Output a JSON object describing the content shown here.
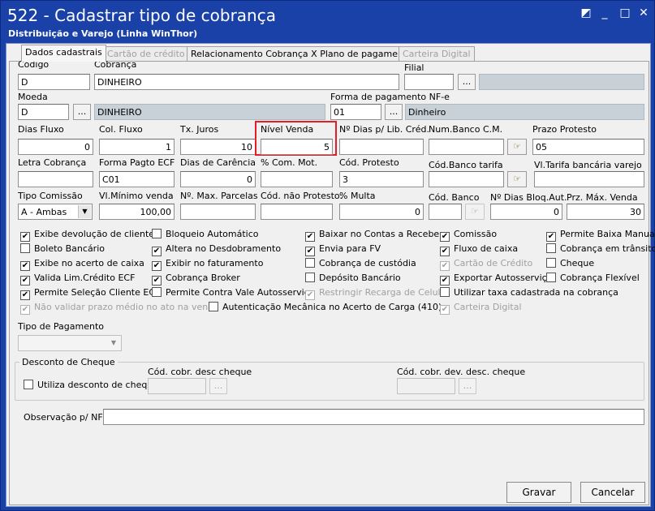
{
  "window": {
    "title": "522 - Cadastrar tipo de cobrança",
    "subtitle": "Distribuição e Varejo (Linha WinThor)",
    "btn_restore": "◩",
    "btn_min": "_",
    "btn_max": "□",
    "btn_close": "✕"
  },
  "tabs": [
    "Dados cadastrais",
    "Cartão de crédito",
    "Relacionamento Cobrança X Plano de pagamento",
    "Carteira Digital"
  ],
  "fields": {
    "codigo": {
      "label": "Código",
      "value": "D"
    },
    "cobranca": {
      "label": "Cobrança",
      "value": "DINHEIRO"
    },
    "filial": {
      "label": "Filial",
      "value": ""
    },
    "moeda": {
      "label": "Moeda",
      "value": "D",
      "desc": "DINHEIRO"
    },
    "forma_pag_nfe": {
      "label": "Forma de pagamento NF-e",
      "value": "01",
      "desc": "Dinheiro"
    },
    "dias_fluxo": {
      "label": "Dias Fluxo",
      "value": "0"
    },
    "col_fluxo": {
      "label": "Col. Fluxo",
      "value": "1"
    },
    "tx_juros": {
      "label": "Tx. Juros",
      "value": "10"
    },
    "nivel_venda": {
      "label": "Nível Venda",
      "value": "5"
    },
    "n_dias_lib": {
      "label": "Nº Dias p/ Lib. Créd.",
      "value": ""
    },
    "num_banco_cm": {
      "label": "Num.Banco C.M.",
      "value": ""
    },
    "prazo_protesto": {
      "label": "Prazo Protesto",
      "value": "05"
    },
    "letra_cobranca": {
      "label": "Letra Cobrança",
      "value": ""
    },
    "forma_pagto_ecf": {
      "label": "Forma Pagto ECF",
      "value": "C01"
    },
    "dias_carencia": {
      "label": "Dias de Carência",
      "value": "0"
    },
    "com_mot": {
      "label": "% Com. Mot.",
      "value": ""
    },
    "cod_protesto": {
      "label": "Cód. Protesto",
      "value": "3"
    },
    "cod_banco_tarifa": {
      "label": "Cód.Banco tarifa",
      "value": ""
    },
    "vl_tarifa": {
      "label": "Vl.Tarifa bancária varejo",
      "value": ""
    },
    "tipo_comissao": {
      "label": "Tipo Comissão",
      "value": "A - Ambas"
    },
    "vl_minimo": {
      "label": "Vl.Mínimo venda",
      "value": "100,00"
    },
    "n_max_parcelas": {
      "label": "Nº. Max. Parcelas",
      "value": ""
    },
    "cod_nao_protesto": {
      "label": "Cód. não Protesto.",
      "value": ""
    },
    "multa": {
      "label": "% Multa",
      "value": "0"
    },
    "cod_banco": {
      "label": "Cód. Banco",
      "value": ""
    },
    "n_dias_bloq": {
      "label": "Nº Dias Bloq.Aut.",
      "value": "0"
    },
    "prz_max_venda": {
      "label": "Prz. Máx. Venda",
      "value": "30"
    }
  },
  "dots": "...",
  "checkboxes": {
    "c1": {
      "label": "Exibe devolução de cliente",
      "checked": "✔"
    },
    "c2": {
      "label": "Boleto Bancário",
      "checked": ""
    },
    "c3": {
      "label": "Exibe no acerto de caixa",
      "checked": "✔"
    },
    "c4": {
      "label": "Valida Lim.Crédito ECF",
      "checked": "✔"
    },
    "c5": {
      "label": "Permite Seleção Cliente ECF",
      "checked": "✔"
    },
    "c6": {
      "label": "Não validar prazo médio no ato na venda",
      "checked": "✔"
    },
    "c7": {
      "label": "Bloqueio Automático",
      "checked": ""
    },
    "c8": {
      "label": "Altera no Desdobramento",
      "checked": "✔"
    },
    "c9": {
      "label": "Exibir no faturamento",
      "checked": "✔"
    },
    "c10": {
      "label": "Cobrança Broker",
      "checked": "✔"
    },
    "c11": {
      "label": "Permite Contra Vale Autosserviço",
      "checked": ""
    },
    "c12": {
      "label": "Autenticação Mecânica no Acerto de Carga (410)",
      "checked": ""
    },
    "c13": {
      "label": "Baixar no Contas a Receber",
      "checked": "✔"
    },
    "c14": {
      "label": "Envia para FV",
      "checked": "✔"
    },
    "c15": {
      "label": "Cobrança de custódia",
      "checked": ""
    },
    "c16": {
      "label": "Depósito Bancário",
      "checked": ""
    },
    "c17": {
      "label": "Restringir Recarga de Celular",
      "checked": "✔"
    },
    "c18": {
      "label": "Comissão",
      "checked": "✔"
    },
    "c19": {
      "label": "Fluxo de caixa",
      "checked": "✔"
    },
    "c20": {
      "label": "Cartão de Crédito",
      "checked": "✔"
    },
    "c21": {
      "label": "Exportar Autosserviço",
      "checked": "✔"
    },
    "c22": {
      "label": "Utilizar taxa cadastrada na cobrança",
      "checked": ""
    },
    "c23": {
      "label": "Carteira Digital",
      "checked": "✔"
    },
    "c24": {
      "label": "Permite Baixa Manual",
      "checked": "✔"
    },
    "c25": {
      "label": "Cobrança em trânsito",
      "checked": ""
    },
    "c26": {
      "label": "Cheque",
      "checked": ""
    },
    "c27": {
      "label": "Cobrança Flexível",
      "checked": ""
    }
  },
  "tipo_pagamento": {
    "label": "Tipo de Pagamento",
    "value": ""
  },
  "desconto_cheque": {
    "title": "Desconto de Cheque",
    "utiliza": "Utiliza desconto de cheque",
    "cod_desc": "Cód. cobr. desc cheque",
    "cod_dev": "Cód. cobr. dev. desc. cheque"
  },
  "observacao": {
    "label": "Observação p/ NF:",
    "value": ""
  },
  "buttons": {
    "gravar": "Gravar",
    "cancelar": "Cancelar"
  },
  "colors": {
    "title_bar": "#1a41a8",
    "highlight": "#e41e26"
  }
}
